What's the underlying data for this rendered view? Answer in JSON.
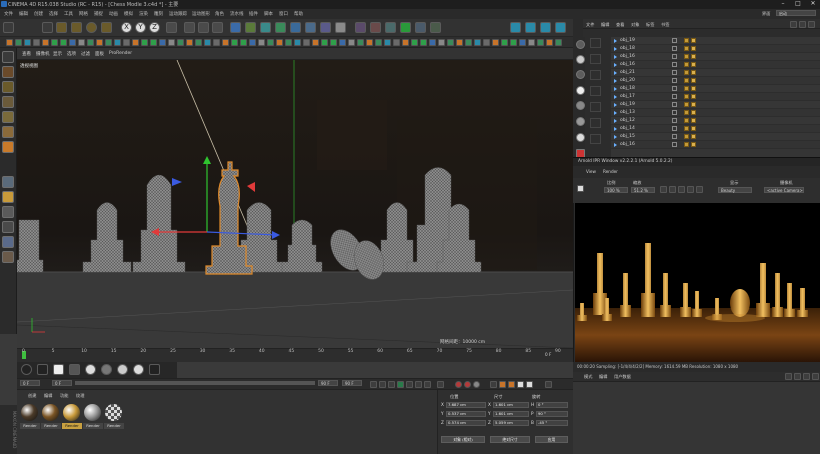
{
  "window": {
    "title": "CINEMA 4D R15.038 Studio (RC - R15) - [Chess Modle 3.c4d *] - 主要",
    "layout_label": "界面",
    "layout_value": "启动"
  },
  "menubar": {
    "items": [
      "文件",
      "编辑",
      "创建",
      "选择",
      "工具",
      "网格",
      "捕捉",
      "动画",
      "模拟",
      "渲染",
      "雕刻",
      "运动跟踪",
      "运动图形",
      "角色",
      "流水线",
      "插件",
      "脚本",
      "窗口",
      "帮助"
    ]
  },
  "toolbar": {
    "axis_labels": [
      "X",
      "Y",
      "Z"
    ]
  },
  "viewport": {
    "menu": [
      "查看",
      "摄像机",
      "显示",
      "选项",
      "过滤",
      "面板",
      "ProRender"
    ],
    "label": "透视视图",
    "grid_spacing": "网格间距：10000 cm"
  },
  "timeline": {
    "ticks": [
      "0",
      "5",
      "10",
      "15",
      "20",
      "25",
      "30",
      "35",
      "40",
      "45",
      "50",
      "55",
      "60",
      "65",
      "70",
      "75",
      "80",
      "85",
      "90"
    ],
    "current_frame": "0 F",
    "start_frame": "0 F",
    "end_frame": "90 F",
    "max_frame": "90 F",
    "right_value": "0 F"
  },
  "materials": {
    "menu": [
      "创建",
      "编辑",
      "功能",
      "纹理"
    ],
    "items": [
      {
        "label": "Render",
        "color": "#4b3a28"
      },
      {
        "label": "Render",
        "color": "#7a5424"
      },
      {
        "label": "Render",
        "color": "#c89a3a"
      },
      {
        "label": "Render",
        "color": "#9a9a9a"
      },
      {
        "label": "Render",
        "color": "#777777"
      }
    ]
  },
  "coordinates": {
    "headers": [
      "位置",
      "尺寸",
      "旋转"
    ],
    "rows": [
      {
        "axis": "X",
        "pos": "7.687 cm",
        "size_axis": "X",
        "size": "1.601 cm",
        "rot_axis": "H",
        "rot": "0 °"
      },
      {
        "axis": "Y",
        "pos": "0.537 cm",
        "size_axis": "Y",
        "size": "1.601 cm",
        "rot_axis": "P",
        "rot": "90 °"
      },
      {
        "axis": "Z",
        "pos": "0.574 cm",
        "size_axis": "Z",
        "size": "5.059 cm",
        "rot_axis": "B",
        "rot": "-45 °"
      }
    ],
    "mode_object": "对象 (相对)",
    "mode_size": "绝对尺寸",
    "apply_button": "应用"
  },
  "objects": {
    "header_menu": [
      "文件",
      "编辑",
      "查看",
      "对象",
      "标签",
      "书签"
    ],
    "rows": [
      "obj_19",
      "obj_18",
      "obj_16",
      "obj_16",
      "obj_21",
      "obj_20",
      "obj_18",
      "obj_17",
      "obj_19",
      "obj_13",
      "obj_12",
      "obj_14",
      "obj_15",
      "obj_16"
    ]
  },
  "ipr": {
    "title": "Arnold IPR Window v2.2.2.1 (Arnold 5.0.2.2)",
    "menu": [
      "View",
      "Render"
    ],
    "labels": {
      "ratio": "比例",
      "zoom": "缩放",
      "display": "显示",
      "camera": "摄像机"
    },
    "ratio_value": "100 %",
    "zoom_value": "51.2 %",
    "display_value": "Beauty",
    "camera_value": "<active Camera>",
    "status": "00:00:20  Sampling: [-1/4/4/4/2/2]  Memory: 1614.59 MB  Resolution: 1080 x 1080"
  },
  "attributes": {
    "menu": [
      "模式",
      "编辑",
      "用户数据"
    ]
  }
}
